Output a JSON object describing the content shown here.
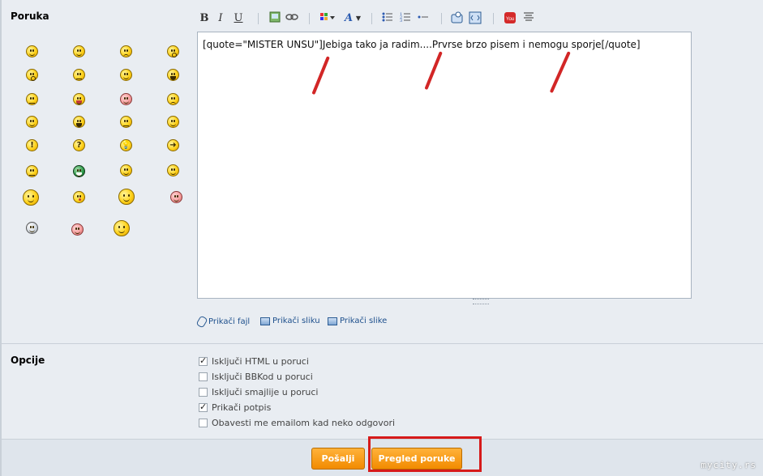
{
  "message_section": {
    "label": "Poruka"
  },
  "options_section": {
    "label": "Opcije"
  },
  "toolbar": {
    "bold": "B",
    "italic": "I",
    "underline": "U",
    "font_color": "A"
  },
  "editor": {
    "content": "[quote=\"MISTER UNSU\"]Jebiga tako ja radim....Prvrse brzo pisem i nemogu sporje[/quote]"
  },
  "attachments": {
    "attach_file": "Prikači fajl",
    "attach_image": "Prikači sliku",
    "attach_images": "Prikači slike"
  },
  "options": [
    {
      "label": "Isključi HTML u poruci",
      "checked": true
    },
    {
      "label": "Isključi BBKod u poruci",
      "checked": false
    },
    {
      "label": "Isključi smajlije u poruci",
      "checked": false
    },
    {
      "label": "Prikači potpis",
      "checked": true
    },
    {
      "label": "Obavesti me emailom kad neko odgovori",
      "checked": false
    }
  ],
  "buttons": {
    "send": "Pošalji",
    "preview": "Pregled poruke"
  },
  "watermark": "mycity.rs",
  "colors": {
    "accent_button": "#f28b00",
    "annotation_red": "#d22626",
    "link": "#1d4f8c"
  }
}
